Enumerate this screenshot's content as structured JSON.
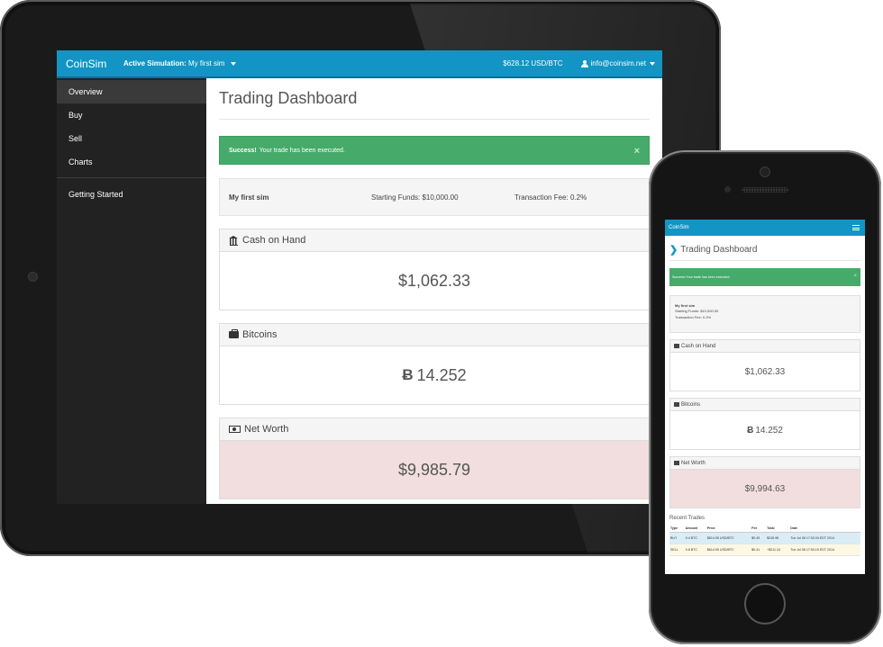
{
  "colors": {
    "navbar": "#1295c4",
    "sidebar": "#222222",
    "success": "#46ab6a",
    "danger_bg": "#f2dede"
  },
  "tablet": {
    "navbar": {
      "brand": "CoinSim",
      "active_sim_label": "Active Simulation:",
      "active_sim_value": "My first sim",
      "price": "$628.12 USD/BTC",
      "user_email": "info@coinsim.net"
    },
    "sidebar": {
      "items": [
        {
          "label": "Overview",
          "active": true
        },
        {
          "label": "Buy"
        },
        {
          "label": "Sell"
        },
        {
          "label": "Charts"
        }
      ],
      "secondary": [
        {
          "label": "Getting Started"
        }
      ]
    },
    "main": {
      "title": "Trading Dashboard",
      "alert": {
        "strong": "Success!",
        "text": "Your trade has been executed.",
        "close": "×"
      },
      "info": {
        "sim_name": "My first sim",
        "starting_funds": "Starting Funds:  $10,000.00",
        "transaction_fee": "Transaction Fee:  0.2%"
      },
      "panels": [
        {
          "title": "Cash on Hand",
          "icon": "bank-icon",
          "value": "$1,062.33"
        },
        {
          "title": "Bitcoins",
          "icon": "briefcase-icon",
          "value": "14.252",
          "symbol": "Ƀ"
        },
        {
          "title": "Net Worth",
          "icon": "money-icon",
          "value": "$9,985.79"
        }
      ]
    }
  },
  "phone": {
    "navbar": {
      "brand": "CoinSim",
      "menu_icon": "hamburger-icon"
    },
    "main": {
      "title": "Trading Dashboard",
      "title_chevron": "❯",
      "alert": {
        "text": "Success! Your trade has been executed.",
        "close": "×"
      },
      "info": {
        "sim_name": "My first sim",
        "starting_funds": "Starting Funds: $10,000.00",
        "transaction_fee": "Transaction Fee: 0.2%"
      },
      "panels": [
        {
          "title": "Cash on Hand",
          "icon": "bank-icon",
          "value": "$1,062.33"
        },
        {
          "title": "Bitcoins",
          "icon": "briefcase-icon",
          "value": "14.252",
          "symbol": "Ƀ"
        },
        {
          "title": "Net Worth",
          "icon": "money-icon",
          "value": "$9,994.63"
        }
      ],
      "recent_trades": {
        "title": "Recent Trades",
        "columns": [
          "Type",
          "Amount",
          "Price",
          "Fee",
          "Total",
          "Date"
        ],
        "rows": [
          {
            "type": "BUY",
            "amount": "0.4 BTC",
            "price": "$614.95 USD/BTC",
            "fee": "$0.49",
            "total": "$245.98",
            "date": "Tue Jul 08 17:53:34 EDT 2014"
          },
          {
            "type": "SELL",
            "amount": "0.8 BTC",
            "price": "$614.95 USD/BTC",
            "fee": "$0.41",
            "total": "+$211.24",
            "date": "Tue Jul 08 17:53:19 EDT 2014"
          }
        ]
      }
    }
  }
}
